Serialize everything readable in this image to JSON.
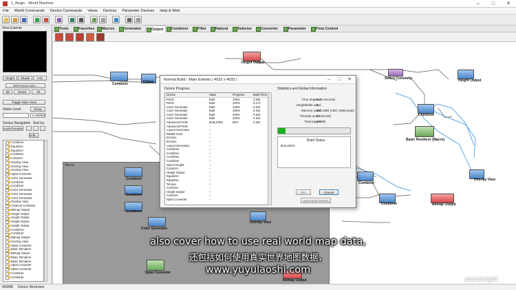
{
  "window": {
    "title": "1_Begin - World Machine",
    "controls": [
      "–",
      "□",
      "✕"
    ]
  },
  "menu": [
    "File",
    "World Commands",
    "Device Commands",
    "Views",
    "Devices",
    "Parameter Devices",
    "Help & Web"
  ],
  "tabs": [
    "Tools",
    "Favorites",
    "Macros",
    "Generator",
    "Output",
    "Combiner",
    "Filter",
    "Natural",
    "Selector",
    "Converter",
    "Parameter",
    "Flow Control"
  ],
  "active_tab": "Output",
  "left_panel": {
    "header": "View Extents",
    "buttons": {
      "height": "Height",
      "shade": "Shade",
      "hybrid": "Hrd",
      "set_focus": "Set Focus Cam...",
      "btn_3d": "3D",
      "reset": "Reset",
      "fit": "Fit",
      "toggle": "Toggle Main View",
      "show": "Show",
      "edit": "Edit..."
    },
    "water_level_label": "Water Level",
    "water_level_value": "0.160000",
    "device_navigation": "Device Navigation",
    "sort_by": "Sort by:",
    "lock_preview": "Lock Preview",
    "devices": [
      "Combiner",
      "Equalizer",
      "Equalizer",
      "Combiner",
      "Colorizer",
      "Overlay View",
      "Overlay View",
      "Overlay View",
      "Splat Converter",
      "Color Generator",
      "Combiner",
      "Combiner",
      "Color Generator",
      "Color Generator",
      "Color Generator",
      "Overlay View",
      "Channel Combiner",
      "Bitmap Output",
      "Height Output",
      "Height Output",
      "Height Output",
      "Height Output",
      "Combiner",
      "Combiner",
      "Bitmap Output",
      "Overlay View",
      "Splat Converter",
      "Basic Renderer",
      "Bitmap Output",
      "Basic Renderer",
      "Basic Renderer",
      "Splat Converter",
      "Splat Converter",
      "Combiner",
      "Combiner"
    ]
  },
  "canvas": {
    "macro_title": "Macro",
    "nodes": [
      {
        "label": "Height Output",
        "color": "red"
      },
      {
        "label": "Combiner",
        "color": "blue"
      },
      {
        "label": "Clamp",
        "color": "blue"
      },
      {
        "label": "Height Output",
        "color": "blue"
      },
      {
        "label": "Select Convexity",
        "color": "purple"
      },
      {
        "label": "Combiner",
        "color": "blue"
      },
      {
        "label": "Basic Renderer (Macro)",
        "color": "green"
      },
      {
        "label": "Overlay View",
        "color": "blue"
      },
      {
        "label": "Combiner",
        "color": "blue"
      },
      {
        "label": "Combiner",
        "color": "blue"
      },
      {
        "label": "Bitmap Output",
        "color": "red"
      },
      {
        "label": "Combiner",
        "color": "blue"
      },
      {
        "label": "Combiner",
        "color": "blue"
      },
      {
        "label": "Combiner",
        "color": "blue"
      },
      {
        "label": "Color Generator",
        "color": "blue"
      },
      {
        "label": "Overlay View",
        "color": "blue"
      },
      {
        "label": "Splat Converter",
        "color": "green"
      },
      {
        "label": "Bitmap Output",
        "color": "red"
      }
    ]
  },
  "dialog": {
    "title": "Normal Build - Main Extents ( 4033 x 4033 )",
    "device_progress_label": "Device Progress",
    "stats_label": "Statistics and Global Information",
    "columns": [
      "Device",
      "State",
      "Progress",
      "Build Time"
    ],
    "rows": [
      [
        "Perlin",
        "Built",
        "100%",
        "2.09s"
      ],
      [
        "Perlin",
        "Built",
        "100%",
        "0.17s"
      ],
      [
        "Color Generator",
        "Built",
        "100%",
        "0.23s"
      ],
      [
        "Color Generator",
        "Built",
        "100%",
        "0.23s"
      ],
      [
        "Color Generator",
        "Built",
        "100%",
        "0.23s"
      ],
      [
        "Color Generator",
        "Built",
        "100%",
        "0.23s"
      ],
      [
        "Advanced Perlin",
        "BUILDING",
        "66%",
        "2.00s"
      ],
      [
        "Advanced Perlin",
        "--",
        "",
        ""
      ],
      [
        "Layout Generator",
        "--",
        "",
        ""
      ],
      [
        "Radial Grad",
        "--",
        "",
        ""
      ],
      [
        "Erosion",
        "--",
        "",
        ""
      ],
      [
        "Erosion",
        "--",
        "",
        ""
      ],
      [
        "Layout Generator",
        "--",
        "",
        ""
      ],
      [
        "Combiner",
        "--",
        "",
        ""
      ],
      [
        "Combiner",
        "--",
        "",
        ""
      ],
      [
        "Combiner",
        "--",
        "",
        ""
      ],
      [
        "Combiner",
        "--",
        "",
        ""
      ],
      [
        "Select Height",
        "--",
        "",
        ""
      ],
      [
        "Colorizer",
        "--",
        "",
        ""
      ],
      [
        "Height Output",
        "--",
        "",
        ""
      ],
      [
        "Equalizer",
        "--",
        "",
        ""
      ],
      [
        "Equalizer",
        "--",
        "",
        ""
      ],
      [
        "Terrace",
        "--",
        "",
        ""
      ],
      [
        "Colorizer",
        "--",
        "",
        ""
      ],
      [
        "Height Output",
        "--",
        "",
        ""
      ],
      [
        "Colorizer",
        "--",
        "",
        ""
      ],
      [
        "Splat Converter",
        "--",
        "",
        ""
      ]
    ],
    "stats": [
      {
        "label": "Time elapsed:",
        "value": "6.25 seconds"
      },
      {
        "label": "Heightfields used:",
        "value": "6"
      },
      {
        "label": "Memory used:",
        "value": "963.2MB (1087.2MB peak)"
      },
      {
        "label": "Threads active:",
        "value": "17 (24.50)"
      },
      {
        "label": "Total pages:",
        "value": "0.0MB"
      }
    ],
    "overall_progress": 0.1,
    "build_status_label": "Build Status",
    "build_status_text": "BUILDING",
    "buttons": {
      "ok": "OK",
      "cancel": "Cancel",
      "save": "Save Build Report"
    }
  },
  "status_bar": {
    "memory": "943MB",
    "device_label": "Device Workview"
  },
  "subtitles": {
    "english": "also cover how to use real world map data,",
    "chinese": "还包括如何使用真实世界地图数据，",
    "url": "www.yuyulaoshi.com"
  },
  "watermark": "pluralsight"
}
